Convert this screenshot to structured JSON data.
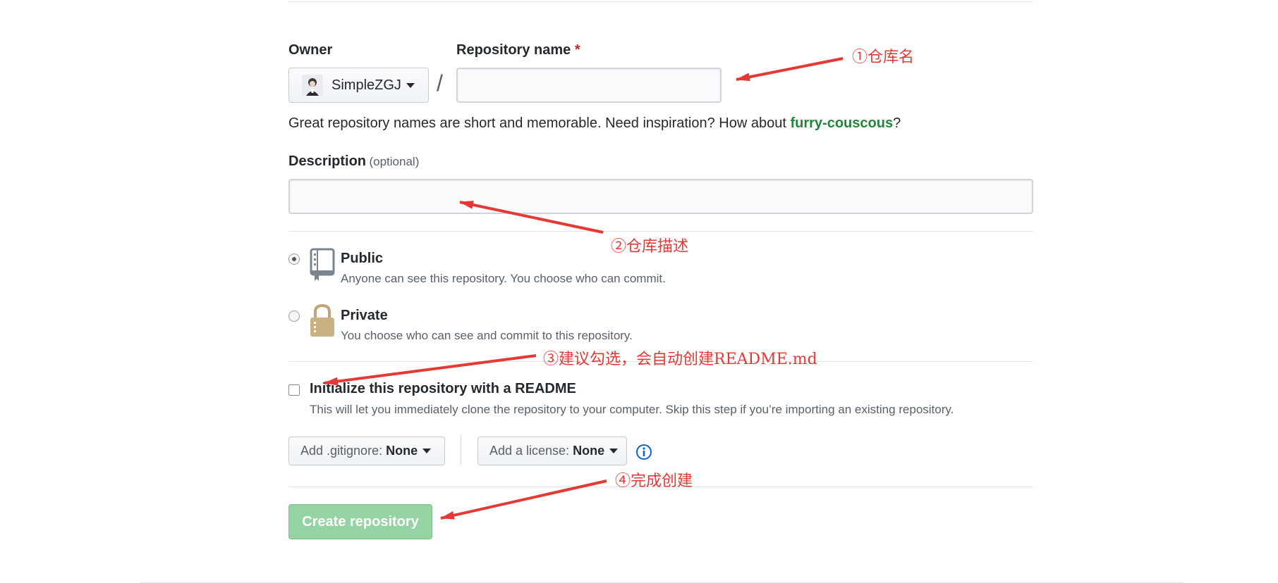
{
  "owner": {
    "label": "Owner",
    "username": "SimpleZGJ"
  },
  "separator": "/",
  "repo_name": {
    "label": "Repository name",
    "required_mark": "*",
    "value": ""
  },
  "name_hint": {
    "text": "Great repository names are short and memorable. Need inspiration? How about ",
    "suggestion": "furry-couscous",
    "end": "?"
  },
  "description": {
    "label": "Description",
    "optional": "(optional)",
    "value": ""
  },
  "visibility": {
    "public": {
      "title": "Public",
      "desc": "Anyone can see this repository. You choose who can commit.",
      "checked": true
    },
    "private": {
      "title": "Private",
      "desc": "You choose who can see and commit to this repository.",
      "checked": false
    }
  },
  "readme": {
    "title": "Initialize this repository with a README",
    "desc": "This will let you immediately clone the repository to your computer. Skip this step if you’re importing an existing repository.",
    "checked": false
  },
  "gitignore": {
    "label": "Add .gitignore:",
    "value": "None"
  },
  "license": {
    "label": "Add a license:",
    "value": "None"
  },
  "info_icon": "info-icon",
  "submit_label": "Create repository",
  "annotations": {
    "a1": "①仓库名",
    "a2": "②仓库描述",
    "a3": "③建议勾选，会自动创建README.md",
    "a4": "④完成创建"
  },
  "colors": {
    "annotation": "#e53935",
    "create_button": "#94d3a2",
    "suggestion": "#22863a",
    "info_icon": "#0366d6"
  }
}
